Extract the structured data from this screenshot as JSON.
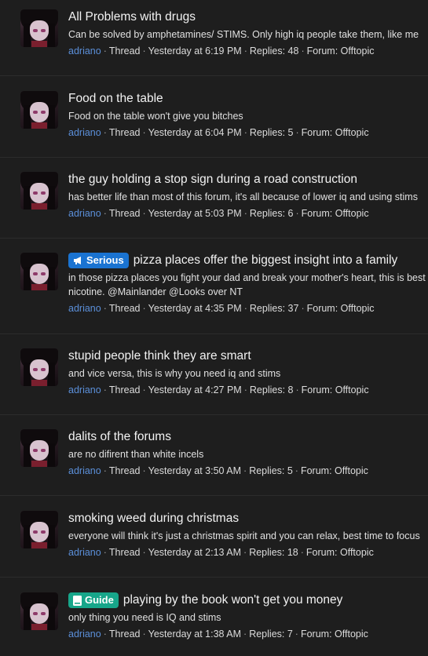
{
  "threads": [
    {
      "title": "All Problems with drugs",
      "snippet": "Can be solved by amphetamines/ STIMS. Only high iq people take them, like me",
      "author": "adriano",
      "type": "Thread",
      "time": "Yesterday at 6:19 PM",
      "replies": "Replies: 48",
      "forum": "Forum: Offtopic"
    },
    {
      "title": "Food on the table",
      "snippet": "Food on the table won't give you bitches",
      "author": "adriano",
      "type": "Thread",
      "time": "Yesterday at 6:04 PM",
      "replies": "Replies: 5",
      "forum": "Forum: Offtopic"
    },
    {
      "title": "the guy holding a stop sign during a road construction",
      "snippet": "has better life than most of this forum, it's all because of lower iq and using stims",
      "author": "adriano",
      "type": "Thread",
      "time": "Yesterday at 5:03 PM",
      "replies": "Replies: 6",
      "forum": "Forum: Offtopic"
    },
    {
      "badge": "Serious",
      "badge_icon": "megaphone-icon",
      "title": "pizza places offer the biggest insight into a family",
      "snippet": "in those pizza places you fight your dad and break your mother's heart, this is best",
      "snippet2": "nicotine. @Mainlander @Looks over NT",
      "author": "adriano",
      "type": "Thread",
      "time": "Yesterday at 4:35 PM",
      "replies": "Replies: 37",
      "forum": "Forum: Offtopic"
    },
    {
      "title": "stupid people think they are smart",
      "snippet": "and vice versa, this is why you need iq and stims",
      "author": "adriano",
      "type": "Thread",
      "time": "Yesterday at 4:27 PM",
      "replies": "Replies: 8",
      "forum": "Forum: Offtopic"
    },
    {
      "title": "dalits of the forums",
      "snippet": "are no difirent than white incels",
      "author": "adriano",
      "type": "Thread",
      "time": "Yesterday at 3:50 AM",
      "replies": "Replies: 5",
      "forum": "Forum: Offtopic"
    },
    {
      "title": "smoking weed during christmas",
      "snippet": "everyone will think it's just a christmas spirit and you can relax, best time to focus",
      "author": "adriano",
      "type": "Thread",
      "time": "Yesterday at 2:13 AM",
      "replies": "Replies: 18",
      "forum": "Forum: Offtopic"
    },
    {
      "badge": "Guide",
      "badge_icon": "book-icon",
      "title": "playing by the book won't get you money",
      "snippet": "only thing you need is IQ and stims",
      "author": "adriano",
      "type": "Thread",
      "time": "Yesterday at 1:38 AM",
      "replies": "Replies: 7",
      "forum": "Forum: Offtopic"
    }
  ],
  "colors": {
    "background": "#1e1e1e",
    "author": "#5b8fd9",
    "serious_badge": "#1a73d1",
    "guide_badge": "#17a68a"
  }
}
